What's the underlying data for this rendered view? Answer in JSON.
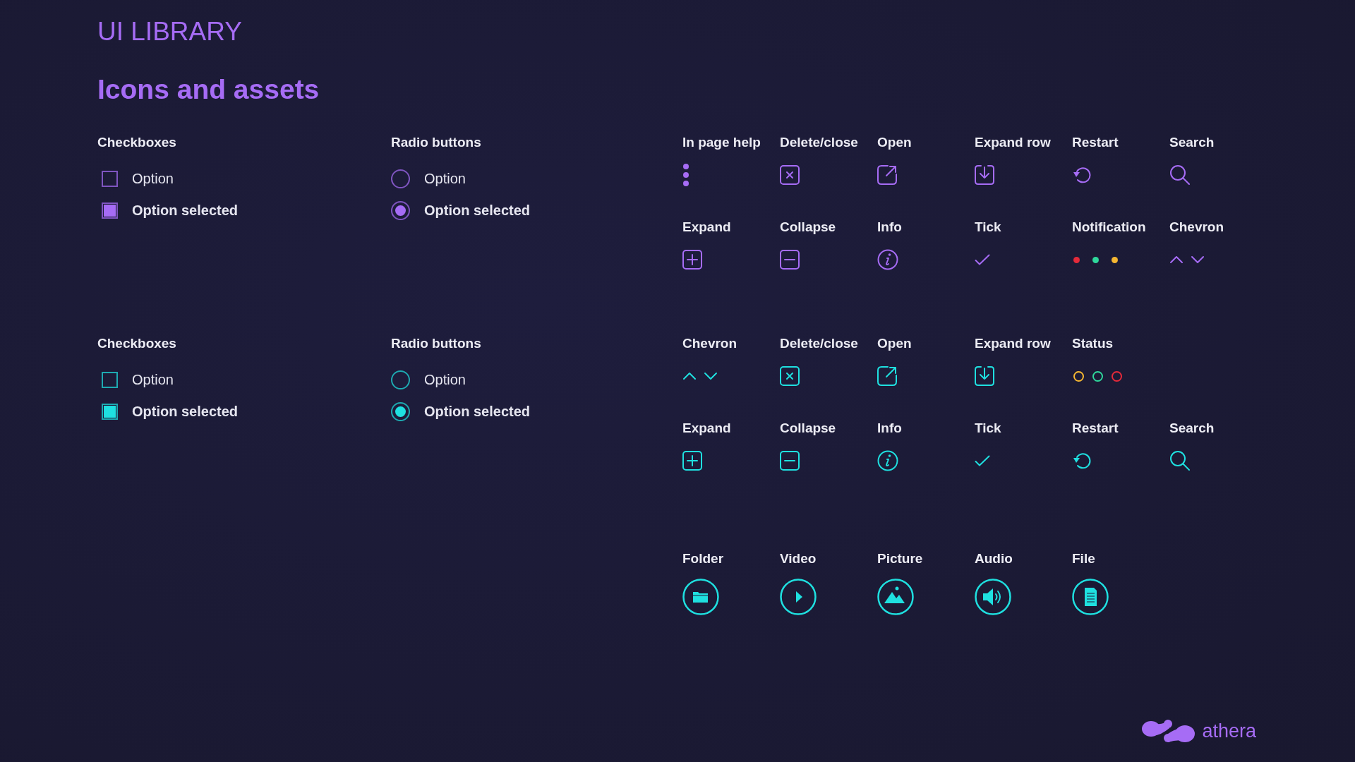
{
  "header": {
    "library_title": "UI LIBRARY",
    "page_title": "Icons and assets"
  },
  "sets": [
    {
      "color": "#a66cf5",
      "checkboxes": {
        "title": "Checkboxes",
        "options": [
          {
            "label": "Option",
            "checked": false
          },
          {
            "label": "Option selected",
            "checked": true
          }
        ]
      },
      "radios": {
        "title": "Radio buttons",
        "options": [
          {
            "label": "Option",
            "selected": false
          },
          {
            "label": "Option selected",
            "selected": true
          }
        ]
      },
      "icon_rows": [
        [
          {
            "label": "In page help",
            "kind": "help"
          },
          {
            "label": "Delete/close",
            "kind": "close"
          },
          {
            "label": "Open",
            "kind": "open"
          },
          {
            "label": "Expand row",
            "kind": "expand_row"
          },
          {
            "label": "Restart",
            "kind": "restart"
          },
          {
            "label": "Search",
            "kind": "search"
          }
        ],
        [
          {
            "label": "Expand",
            "kind": "plus"
          },
          {
            "label": "Collapse",
            "kind": "minus"
          },
          {
            "label": "Info",
            "kind": "info"
          },
          {
            "label": "Tick",
            "kind": "tick"
          },
          {
            "label": "Notification",
            "kind": "dots",
            "dots": [
              {
                "color": "#e52a3a"
              },
              {
                "color": "#2fd89c"
              },
              {
                "color": "#f5b732"
              }
            ]
          },
          {
            "label": "Chevron",
            "kind": "chevrons"
          }
        ]
      ]
    },
    {
      "color": "#1fe0e0",
      "checkboxes": {
        "title": "Checkboxes",
        "options": [
          {
            "label": "Option",
            "checked": false
          },
          {
            "label": "Option selected",
            "checked": true
          }
        ]
      },
      "radios": {
        "title": "Radio buttons",
        "options": [
          {
            "label": "Option",
            "selected": false
          },
          {
            "label": "Option selected",
            "selected": true
          }
        ]
      },
      "icon_rows": [
        [
          {
            "label": "Chevron",
            "kind": "chevrons"
          },
          {
            "label": "Delete/close",
            "kind": "close"
          },
          {
            "label": "Open",
            "kind": "open"
          },
          {
            "label": "Expand row",
            "kind": "expand_row"
          },
          {
            "label": "Status",
            "kind": "rings",
            "dots": [
              {
                "color": "#f5b732"
              },
              {
                "color": "#2fd89c"
              },
              {
                "color": "#e52a3a"
              }
            ]
          }
        ],
        [
          {
            "label": "Expand",
            "kind": "plus"
          },
          {
            "label": "Collapse",
            "kind": "minus"
          },
          {
            "label": "Info",
            "kind": "info"
          },
          {
            "label": "Tick",
            "kind": "tick"
          },
          {
            "label": "Restart",
            "kind": "restart"
          },
          {
            "label": "Search",
            "kind": "search"
          }
        ]
      ]
    }
  ],
  "media": [
    {
      "label": "Folder",
      "kind": "folder"
    },
    {
      "label": "Video",
      "kind": "video"
    },
    {
      "label": "Picture",
      "kind": "picture"
    },
    {
      "label": "Audio",
      "kind": "audio"
    },
    {
      "label": "File",
      "kind": "file"
    }
  ],
  "logo": {
    "text": "athera"
  }
}
